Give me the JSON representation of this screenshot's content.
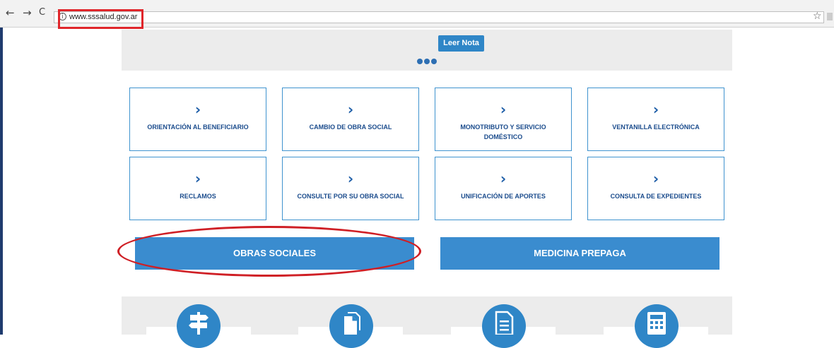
{
  "browser": {
    "back_icon": "←",
    "forward_icon": "→",
    "reload_icon": "C",
    "url": "www.sssalud.gov.ar",
    "star_icon": "☆"
  },
  "banner": {
    "read_note_label": "Leer Nota"
  },
  "tiles": [
    {
      "label": "ORIENTACIÓN AL BENEFICIARIO"
    },
    {
      "label": "CAMBIO DE OBRA SOCIAL"
    },
    {
      "label": "MONOTRIBUTO Y SERVICIO DOMÉSTICO"
    },
    {
      "label": "VENTANILLA ELECTRÓNICA"
    },
    {
      "label": "RECLAMOS"
    },
    {
      "label": "CONSULTE POR SU OBRA SOCIAL"
    },
    {
      "label": "UNIFICACIÓN DE APORTES"
    },
    {
      "label": "CONSULTA DE EXPEDIENTES"
    }
  ],
  "chevron_glyph": "›",
  "actions": {
    "obras_sociales": "OBRAS SOCIALES",
    "medicina_prepaga": "MEDICINA PREPAGA"
  },
  "colors": {
    "primary_blue": "#3a8ccf",
    "dark_blue_text": "#1a4b8c",
    "annotation_red": "#e0262b"
  },
  "bottom_icons": [
    "signpost-icon",
    "documents-icon",
    "document-list-icon",
    "calculator-icon"
  ]
}
